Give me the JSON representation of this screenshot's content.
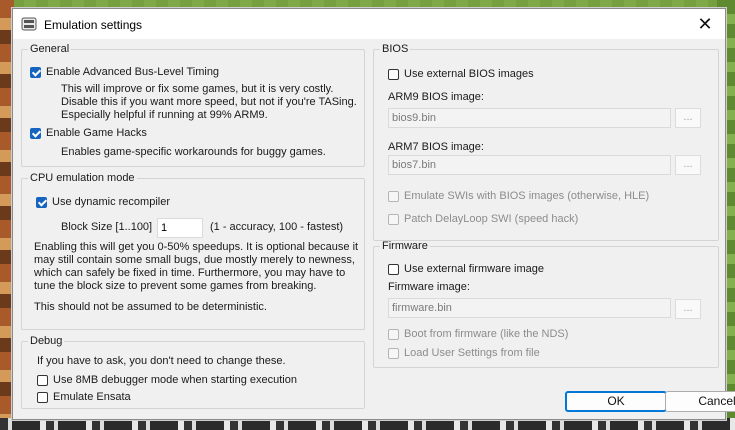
{
  "window": {
    "title": "Emulation settings",
    "close_glyph": "✕"
  },
  "general": {
    "legend": "General",
    "bus_timing": {
      "label": "Enable Advanced Bus-Level Timing",
      "checked": true,
      "notes": [
        "This will improve or fix some games, but it is very costly.",
        "Disable this if you want more speed, but not if you're TASing.",
        "Especially helpful if running at 99% ARM9."
      ]
    },
    "game_hacks": {
      "label": "Enable Game Hacks",
      "checked": true,
      "note": "Enables game-specific workarounds for buggy games."
    }
  },
  "cpu": {
    "legend": "CPU emulation mode",
    "dynarec": {
      "label": "Use dynamic recompiler",
      "checked": true
    },
    "block_size_label": "Block Size [1..100]",
    "block_size_value": "1",
    "block_size_hint": "(1 - accuracy, 100 - fastest)",
    "description": [
      "Enabling this will get you 0-50% speedups. It is optional because it",
      "may still contain some small bugs, due mostly merely to newness,",
      "which can safely be fixed in time. Furthermore, you may have to",
      "tune the block size to prevent some games from breaking."
    ],
    "warning": "This should not be assumed to be deterministic."
  },
  "debug": {
    "legend": "Debug",
    "note": "If you have to ask, you don't need to change these.",
    "debugger_8mb": {
      "label": "Use 8MB debugger mode when starting execution",
      "checked": false
    },
    "ensata": {
      "label": "Emulate Ensata",
      "checked": false
    }
  },
  "bios": {
    "legend": "BIOS",
    "use_external": {
      "label": "Use external BIOS images",
      "checked": false
    },
    "arm9_label": "ARM9 BIOS image:",
    "arm9_value": "bios9.bin",
    "arm7_label": "ARM7 BIOS image:",
    "arm7_value": "bios7.bin",
    "browse_label": "...",
    "emulate_swi": {
      "label": "Emulate SWIs with BIOS images (otherwise, HLE)",
      "checked": false
    },
    "patch_delayloop": {
      "label": "Patch DelayLoop SWI (speed hack)",
      "checked": false
    }
  },
  "firmware": {
    "legend": "Firmware",
    "use_external": {
      "label": "Use external firmware image",
      "checked": false
    },
    "image_label": "Firmware image:",
    "image_value": "firmware.bin",
    "browse_label": "...",
    "boot_from_fw": {
      "label": "Boot from firmware (like the NDS)",
      "checked": false
    },
    "load_user_settings": {
      "label": "Load User Settings from file",
      "checked": false
    }
  },
  "buttons": {
    "ok": "OK",
    "cancel": "Cancel"
  },
  "colors": {
    "accent": "#1565c0",
    "default_button_border": "#0078d7"
  }
}
